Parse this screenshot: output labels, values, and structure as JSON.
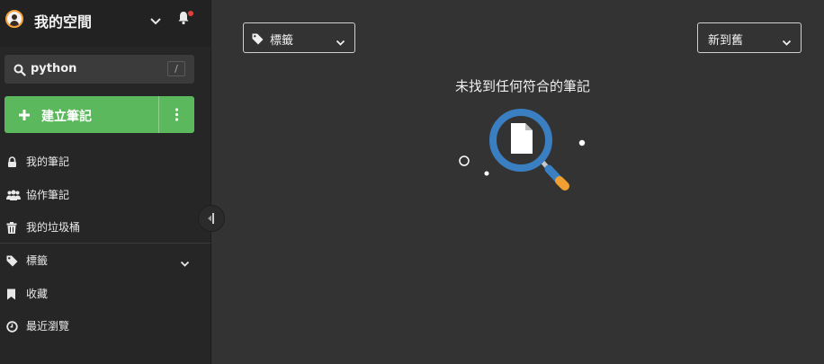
{
  "sidebar": {
    "space_title": "我的空間",
    "search": {
      "value": "python",
      "shortcut": "/"
    },
    "create_label": "建立筆記",
    "items": [
      {
        "label": "我的筆記",
        "icon": "lock-icon"
      },
      {
        "label": "協作筆記",
        "icon": "users-icon"
      },
      {
        "label": "我的垃圾桶",
        "icon": "trash-icon"
      },
      {
        "label": "標籤",
        "icon": "tag-icon"
      },
      {
        "label": "收藏",
        "icon": "bookmark-icon"
      },
      {
        "label": "最近瀏覽",
        "icon": "clock-icon"
      }
    ],
    "notification_badge_color": "#e0403b"
  },
  "main": {
    "tag_filter_label": "標籤",
    "sort_label": "新到舊",
    "empty_message": "未找到任何符合的筆記"
  },
  "colors": {
    "accent_green": "#5cb85c",
    "background": "#333333",
    "sidebar": "#262626",
    "magnifier_blue": "#3a7fc1",
    "handle_orange": "#f0a030"
  }
}
